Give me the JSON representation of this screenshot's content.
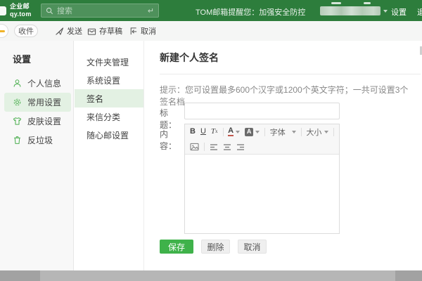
{
  "colors": {
    "header_green": "#2d7d3c",
    "accent_green": "#3fb24a",
    "selected_bg": "#e3f1e3"
  },
  "header": {
    "logo_line1": "企业邮",
    "logo_line2": "qy.tom",
    "search_placeholder": "搜索",
    "notice": "TOM邮箱提醒您：加强安全防控",
    "settings_label": "设置",
    "logout_label": "退出"
  },
  "toolbar": {
    "receive_label": "收件",
    "send_label": "发送",
    "draft_label": "存草稿",
    "cancel_label": "取消"
  },
  "sidebar": {
    "title": "设置",
    "items": [
      {
        "icon": "user-icon",
        "label": "个人信息",
        "selected": false
      },
      {
        "icon": "gear-icon",
        "label": "常用设置",
        "selected": true
      },
      {
        "icon": "tshirt-icon",
        "label": "皮肤设置",
        "selected": false
      },
      {
        "icon": "trash-icon",
        "label": "反垃圾",
        "selected": false
      }
    ]
  },
  "subnav": {
    "items": [
      {
        "label": "文件夹管理",
        "selected": false
      },
      {
        "label": "系统设置",
        "selected": false
      },
      {
        "label": "签名",
        "selected": true
      },
      {
        "label": "来信分类",
        "selected": false
      },
      {
        "label": "随心邮设置",
        "selected": false
      }
    ]
  },
  "main": {
    "title": "新建个人签名",
    "hint": "提示：您可设置最多600个汉字或1200个英文字符；一共可设置3个签名档。",
    "form": {
      "title_label": "标题：",
      "title_value": "",
      "content_label": "内容：",
      "editor": {
        "bold": "B",
        "underline": "U",
        "remove_format": "T",
        "remove_format_sub": "x",
        "text_color": "A",
        "bg_color": "A",
        "font_label": "字体",
        "size_label": "大小"
      }
    },
    "buttons": {
      "save": "保存",
      "delete": "删除",
      "cancel": "取消"
    }
  }
}
